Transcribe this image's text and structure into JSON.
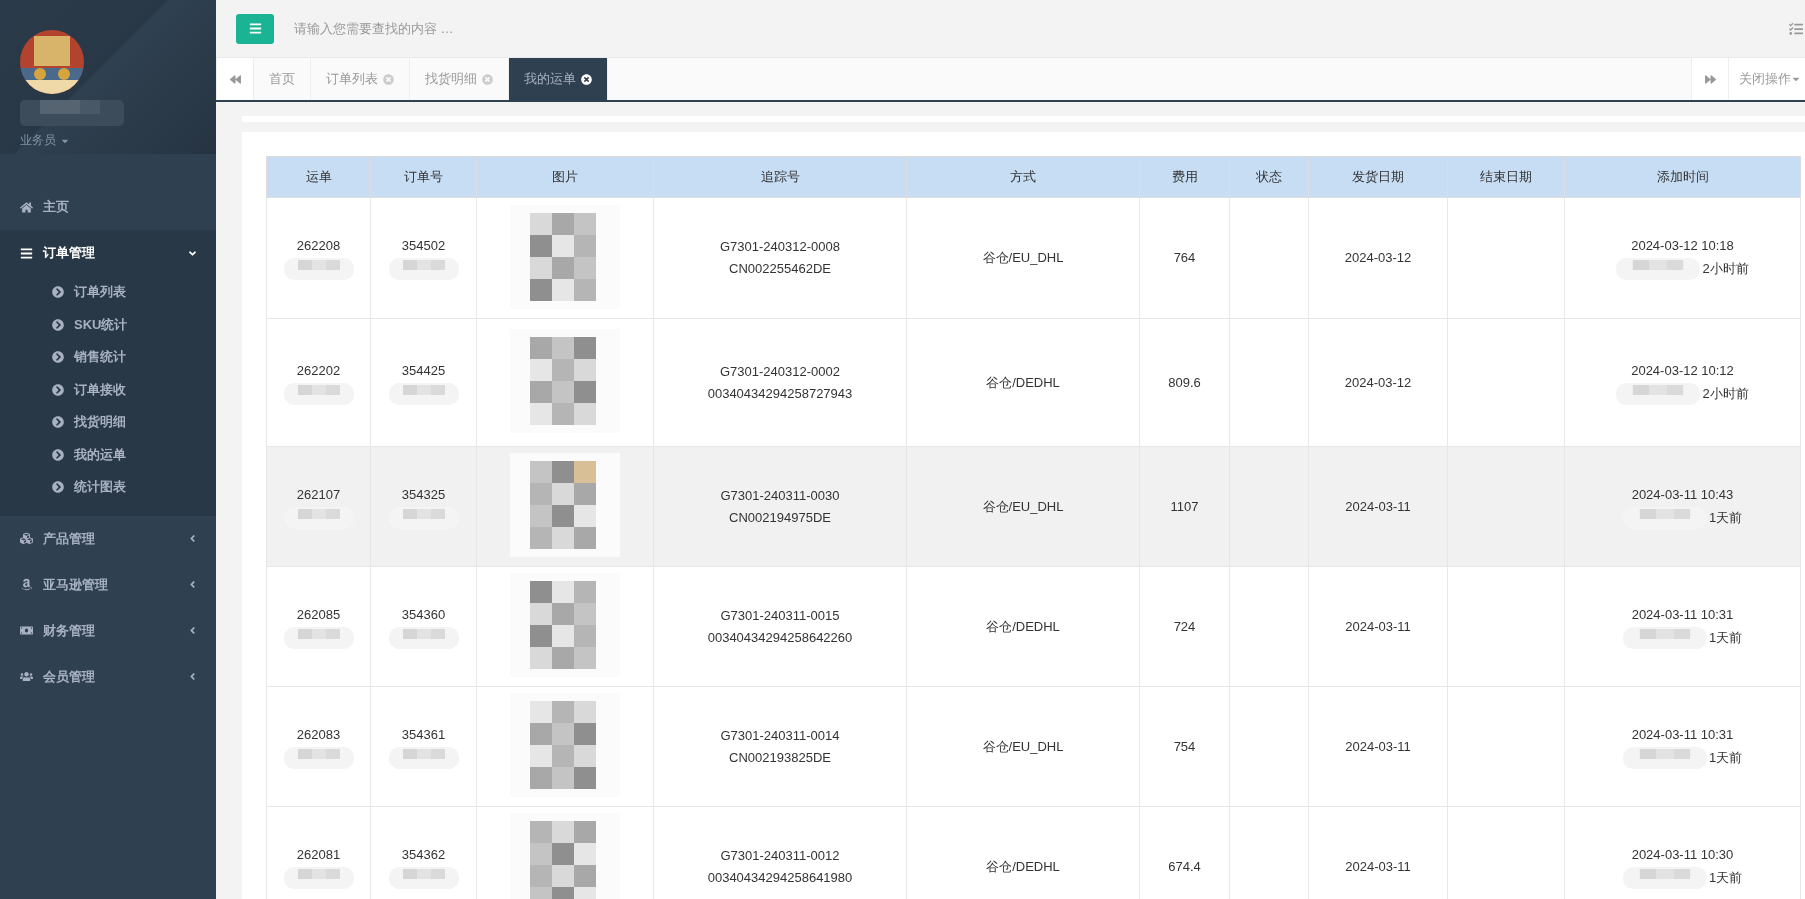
{
  "search": {
    "placeholder": "请输入您需要查找的内容 …"
  },
  "user": {
    "role": "业务员"
  },
  "sidebar": {
    "items": [
      {
        "label": "主页"
      },
      {
        "label": "订单管理",
        "expanded": true,
        "children": [
          {
            "label": "订单列表"
          },
          {
            "label": "SKU统计"
          },
          {
            "label": "销售统计"
          },
          {
            "label": "订单接收"
          },
          {
            "label": "找货明细"
          },
          {
            "label": "我的运单"
          },
          {
            "label": "统计图表"
          }
        ]
      },
      {
        "label": "产品管理",
        "expanded": false
      },
      {
        "label": "亚马逊管理",
        "expanded": false
      },
      {
        "label": "财务管理",
        "expanded": false
      },
      {
        "label": "会员管理",
        "expanded": false
      }
    ]
  },
  "tabs": [
    {
      "label": "首页",
      "selected": false,
      "closable": false
    },
    {
      "label": "订单列表",
      "selected": false,
      "closable": true
    },
    {
      "label": "找货明细",
      "selected": false,
      "closable": true
    },
    {
      "label": "我的运单",
      "selected": true,
      "closable": true
    }
  ],
  "tab_actions": {
    "close_menu": "关闭操作"
  },
  "table": {
    "columns": [
      "运单",
      "订单号",
      "图片",
      "追踪号",
      "方式",
      "费用",
      "状态",
      "发货日期",
      "结束日期",
      "添加时间"
    ],
    "rows": [
      {
        "highlighted": false,
        "waybill": "262208",
        "order_no": "354502",
        "tracking": [
          "G7301-240312-0008",
          "CN002255462DE"
        ],
        "method": "谷仓/EU_DHL",
        "fee": "764",
        "ship_date": "2024-03-12",
        "added_time": "2024-03-12 10:18",
        "added_relative": "2小时前"
      },
      {
        "highlighted": false,
        "waybill": "262202",
        "order_no": "354425",
        "tracking": [
          "G7301-240312-0002",
          "00340434294258727943"
        ],
        "method": "谷仓/DEDHL",
        "fee": "809.6",
        "ship_date": "2024-03-12",
        "added_time": "2024-03-12 10:12",
        "added_relative": "2小时前"
      },
      {
        "highlighted": true,
        "waybill": "262107",
        "order_no": "354325",
        "tracking": [
          "G7301-240311-0030",
          "CN002194975DE"
        ],
        "method": "谷仓/EU_DHL",
        "fee": "1107",
        "ship_date": "2024-03-11",
        "added_time": "2024-03-11 10:43",
        "added_relative": "1天前"
      },
      {
        "highlighted": false,
        "waybill": "262085",
        "order_no": "354360",
        "tracking": [
          "G7301-240311-0015",
          "00340434294258642260"
        ],
        "method": "谷仓/DEDHL",
        "fee": "724",
        "ship_date": "2024-03-11",
        "added_time": "2024-03-11 10:31",
        "added_relative": "1天前"
      },
      {
        "highlighted": false,
        "waybill": "262083",
        "order_no": "354361",
        "tracking": [
          "G7301-240311-0014",
          "CN002193825DE"
        ],
        "method": "谷仓/EU_DHL",
        "fee": "754",
        "ship_date": "2024-03-11",
        "added_time": "2024-03-11 10:31",
        "added_relative": "1天前"
      },
      {
        "highlighted": false,
        "waybill": "262081",
        "order_no": "354362",
        "tracking": [
          "G7301-240311-0012",
          "00340434294258641980"
        ],
        "method": "谷仓/DEDHL",
        "fee": "674.4",
        "ship_date": "2024-03-11",
        "added_time": "2024-03-11 10:30",
        "added_relative": "1天前"
      }
    ]
  }
}
